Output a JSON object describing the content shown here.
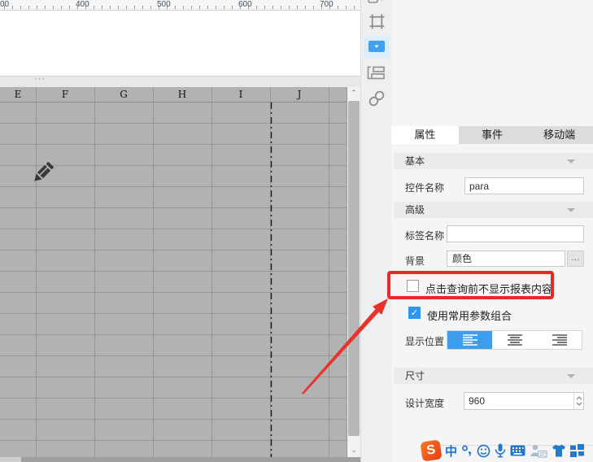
{
  "ruler": {
    "labels": [
      "00",
      "400",
      "500",
      "600",
      "700"
    ]
  },
  "collapse_handle": "···",
  "grid": {
    "columns": [
      "E",
      "F",
      "G",
      "H",
      "I",
      "J"
    ]
  },
  "side_toolbar": {
    "icons": [
      "partial-top-icon",
      "frame-widget-icon",
      "dropdown-widget-icon",
      "tab-layout-icon",
      "link-icon"
    ],
    "selected_icon": "dropdown-widget-icon"
  },
  "panel": {
    "tabs": [
      {
        "label": "属性",
        "active": true
      },
      {
        "label": "事件",
        "active": false
      },
      {
        "label": "移动端",
        "active": false
      }
    ],
    "sections": {
      "basic": "基本",
      "advanced": "高级",
      "size": "尺寸"
    },
    "fields": {
      "widget_name_label": "控件名称",
      "widget_name_value": "para",
      "tag_name_label": "标签名称",
      "tag_name_value": "",
      "background_label": "背景",
      "background_value": "颜色",
      "background_more": "…",
      "no_display_label": "点击查询前不显示报表内容",
      "no_display_checked": false,
      "common_params_label": "使用常用参数组合",
      "common_params_checked": true,
      "common_params_check_glyph": "✓",
      "display_position_label": "显示位置",
      "display_position_selected": "left",
      "design_width_label": "设计宽度",
      "design_width_value": "960"
    }
  },
  "ime_bar": {
    "logo_text": "S",
    "mode_text": "中",
    "icons": [
      "sogou-logo",
      "chinese-mode",
      "punctuation-icon",
      "emoji-icon",
      "microphone-icon",
      "keyboard-icon",
      "profile-card-icon",
      "skin-tshirt-icon",
      "toolbox-grid-icon"
    ]
  },
  "colors": {
    "accent_blue": "#3f9df0",
    "highlight_red": "#e62a2a",
    "grid_gray": "#b2b2b2",
    "sogou_orange": "#f05523"
  }
}
